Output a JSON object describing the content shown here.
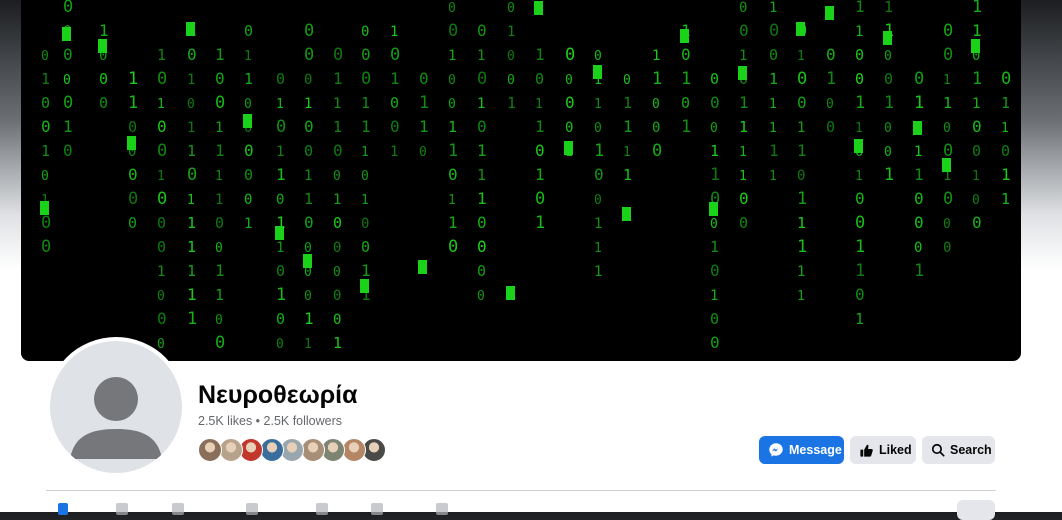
{
  "page": {
    "name": "Νευροθεωρία",
    "stats": "2.5K likes • 2.5K followers"
  },
  "cover": {
    "description_icon": "matrix-code-rain",
    "rain_color": "#1bd21b"
  },
  "friends_liked": [
    "#8a6f5a",
    "#b7a28b",
    "#c2372b",
    "#3b6d9c",
    "#9aa6ad",
    "#a68e77",
    "#7d8472",
    "#b48665",
    "#4a4a48"
  ],
  "actions": {
    "message_label": "Message",
    "liked_label": "Liked",
    "search_label": "Search"
  },
  "colors": {
    "accent": "#1b74e4",
    "button_secondary": "#e4e6eb"
  }
}
